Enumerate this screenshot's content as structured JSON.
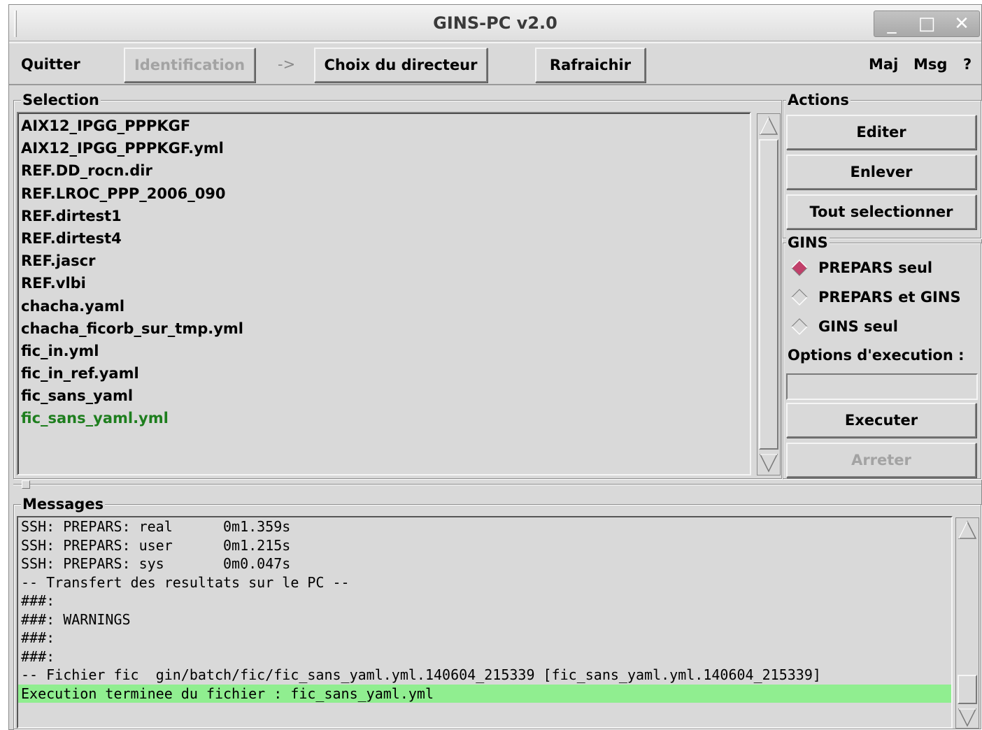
{
  "window": {
    "title": "GINS-PC v2.0",
    "controls": {
      "minimize": "_",
      "maximize": "□",
      "close": "✕"
    }
  },
  "toolbar": {
    "quit": "Quitter",
    "identification": "Identification",
    "arrow": "->",
    "choose_dir": "Choix du directeur",
    "refresh": "Rafraichir",
    "maj": "Maj",
    "msg": "Msg",
    "help": "?"
  },
  "selection": {
    "label": "Selection",
    "items": [
      "AIX12_IPGG_PPPKGF",
      "AIX12_IPGG_PPPKGF.yml",
      "REF.DD_rocn.dir",
      "REF.LROC_PPP_2006_090",
      "REF.dirtest1",
      "REF.dirtest4",
      "REF.jascr",
      "REF.vlbi",
      "chacha.yaml",
      "chacha_ficorb_sur_tmp.yml",
      "fic_in.yml",
      "fic_in_ref.yaml",
      "fic_sans_yaml",
      "fic_sans_yaml.yml"
    ],
    "highlight_color": "#1e7e1e"
  },
  "actions": {
    "label": "Actions",
    "edit": "Editer",
    "remove": "Enlever",
    "select_all": "Tout selectionner"
  },
  "gins": {
    "label": "GINS",
    "options": [
      "PREPARS seul",
      "PREPARS et GINS",
      "GINS seul"
    ],
    "selected": "PREPARS seul",
    "exec_options_label": "Options d'execution :",
    "exec_options_value": "",
    "execute": "Executer",
    "stop": "Arreter"
  },
  "messages": {
    "label": "Messages",
    "lines": [
      "SSH: PREPARS: real      0m1.359s",
      "SSH: PREPARS: user      0m1.215s",
      "SSH: PREPARS: sys       0m0.047s",
      "-- Transfert des resultats sur le PC --",
      "###:",
      "###: WARNINGS",
      "###:",
      "###:",
      "-- Fichier fic  gin/batch/fic/fic_sans_yaml.yml.140604_215339 [fic_sans_yaml.yml.140604_215339]",
      "Execution terminee du fichier : fic_sans_yaml.yml"
    ],
    "success_color": "#90ee90"
  }
}
